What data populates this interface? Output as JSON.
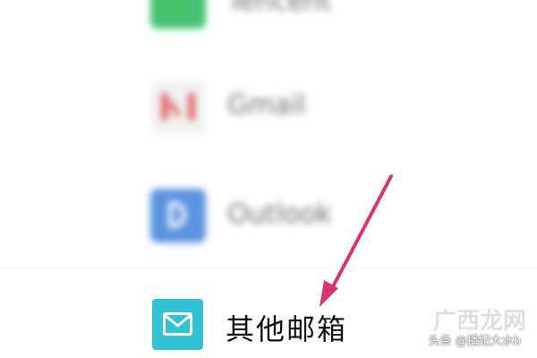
{
  "accounts": [
    {
      "id": "qq",
      "label": "Tencent",
      "icon": "qq-mail-icon",
      "color": "#46c26f"
    },
    {
      "id": "gmail",
      "label": "Gmail",
      "icon": "gmail-icon",
      "color": "#e06a6a"
    },
    {
      "id": "outlook",
      "label": "Outlook",
      "icon": "outlook-icon",
      "color": "#5b93e0"
    }
  ],
  "other_mailbox": {
    "label": "其他邮箱",
    "icon": "envelope-icon",
    "color": "#33c1d6"
  },
  "annotation": {
    "arrow_color": "#d6356f"
  },
  "watermark": {
    "logo": "广西龙网",
    "credit": "头条 @播妃大水b"
  }
}
